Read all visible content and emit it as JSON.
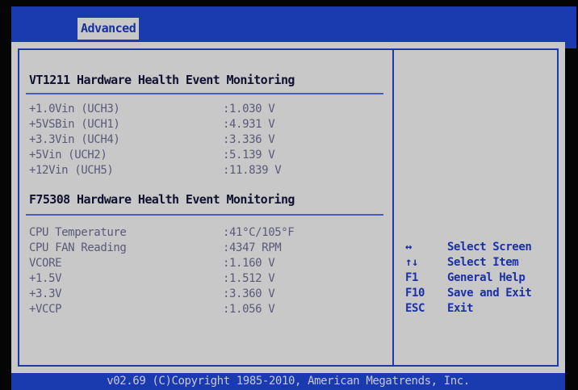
{
  "header": {
    "active_tab": "Advanced"
  },
  "section1": {
    "title": "VT1211 Hardware Health Event Monitoring",
    "rows": [
      {
        "label": "+1.0Vin (UCH3)",
        "value": ":1.030 V"
      },
      {
        "label": "+5VSBin (UCH1)",
        "value": ":4.931 V"
      },
      {
        "label": "+3.3Vin (UCH4)",
        "value": ":3.336 V"
      },
      {
        "label": "+5Vin (UCH2)",
        "value": ":5.139 V"
      },
      {
        "label": "+12Vin (UCH5)",
        "value": ":11.839 V"
      }
    ]
  },
  "section2": {
    "title": "F75308 Hardware Health Event Monitoring",
    "rows": [
      {
        "label": "CPU Temperature",
        "value": ":41°C/105°F"
      },
      {
        "label": "CPU FAN Reading",
        "value": ":4347 RPM"
      },
      {
        "label": "VCORE",
        "value": ":1.160 V"
      },
      {
        "label": "+1.5V",
        "value": ":1.512 V"
      },
      {
        "label": "+3.3V",
        "value": ":3.360 V"
      },
      {
        "label": "+VCCP",
        "value": ":1.056 V"
      }
    ]
  },
  "help": [
    {
      "key": "↔",
      "desc": "Select Screen"
    },
    {
      "key": "↑↓",
      "desc": "Select Item"
    },
    {
      "key": "F1",
      "desc": "General Help"
    },
    {
      "key": "F10",
      "desc": "Save and Exit"
    },
    {
      "key": "ESC",
      "desc": "Exit"
    }
  ],
  "footer": {
    "text": "v02.69 (C)Copyright 1985-2010, American Megatrends, Inc."
  },
  "colors": {
    "bios_blue": "#1a3bb0",
    "panel_gray": "#c8c8c8",
    "value_text": "#5a5a78",
    "help_text": "#1a30a8"
  }
}
